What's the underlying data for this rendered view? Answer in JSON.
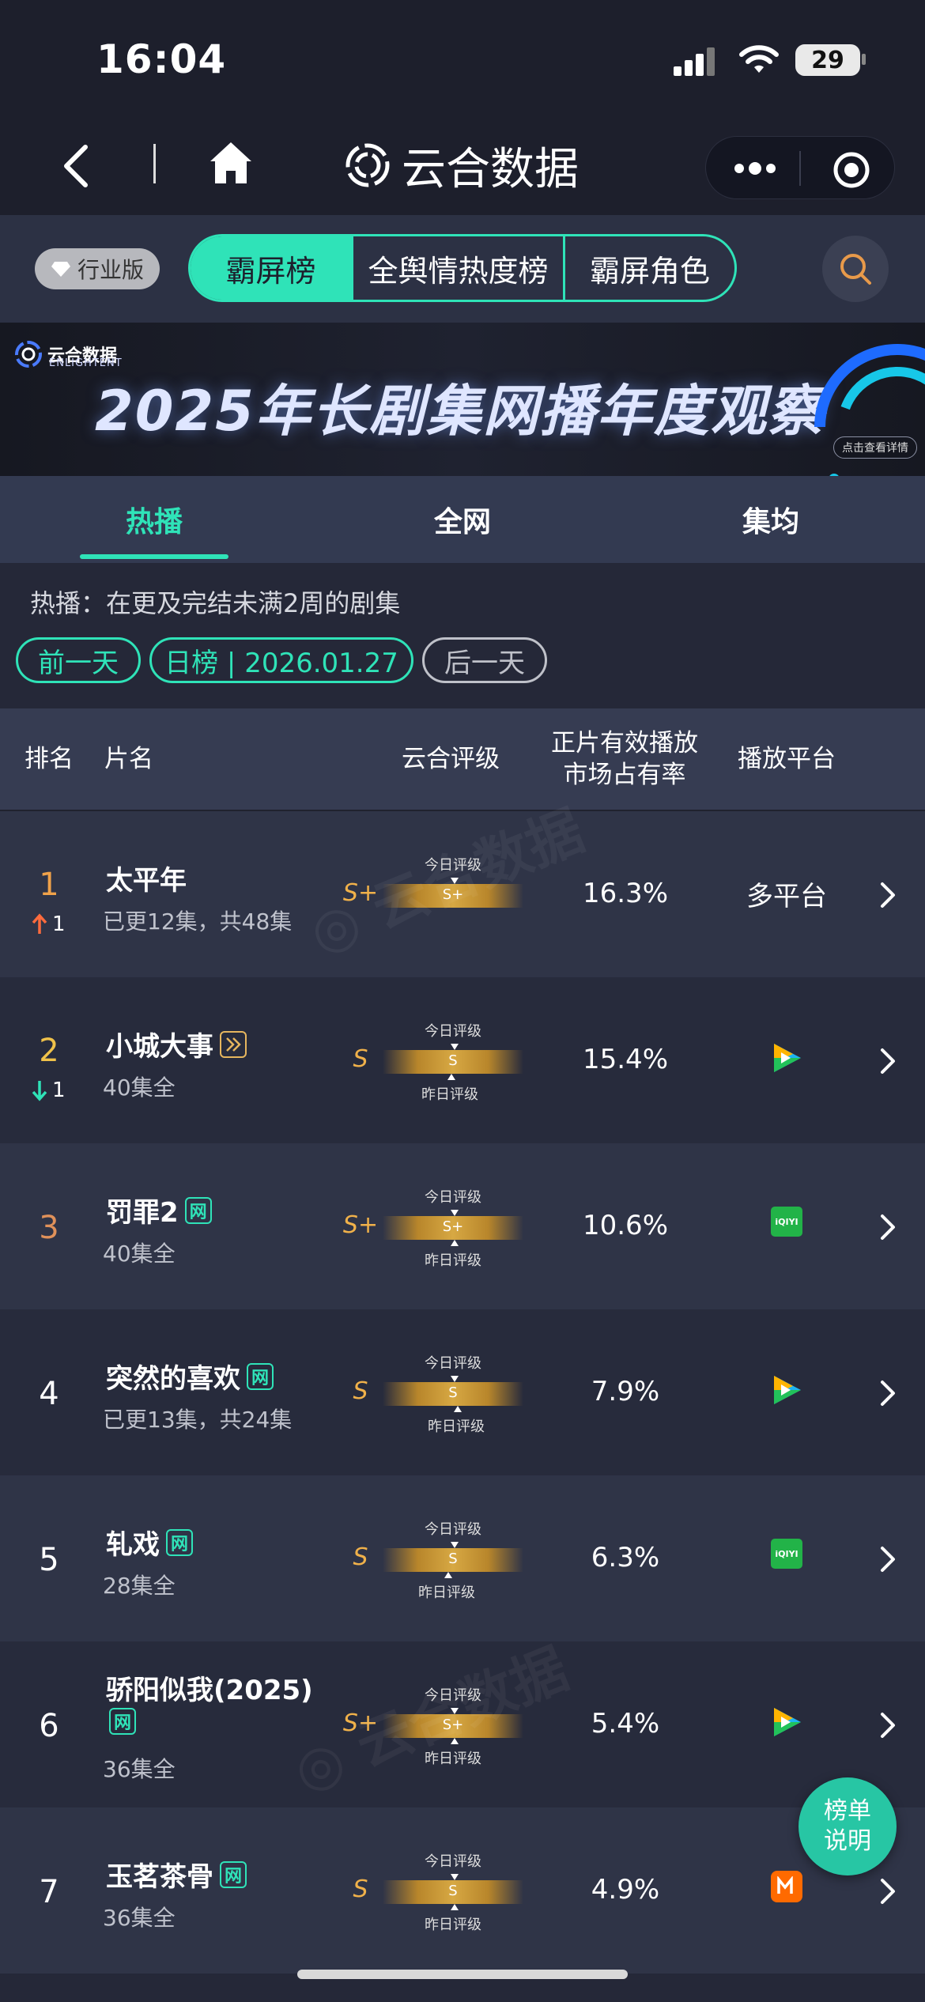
{
  "status_bar": {
    "time": "16:04",
    "battery": "29"
  },
  "nav": {
    "title": "云合数据"
  },
  "toolbar": {
    "edition": "行业版",
    "segments": [
      "霸屏榜",
      "全舆情热度榜",
      "霸屏角色"
    ],
    "active_segment": "霸屏榜"
  },
  "banner": {
    "logo": "云合数据",
    "logo_sub": "ENLIGHTENT",
    "title": "2025年长剧集网播年度观察",
    "detail_link": "点击查看详情"
  },
  "tabs": [
    {
      "label": "热播"
    },
    {
      "label": "全网"
    },
    {
      "label": "集均"
    }
  ],
  "info": {
    "description": "热播：在更及完结未满2周的剧集",
    "prev_day": "前一天",
    "date_pill": "日榜 | 2026.01.27",
    "next_day": "后一天"
  },
  "table": {
    "headers": {
      "rank": "排名",
      "name": "片名",
      "rating": "云合评级",
      "share_line1": "正片有效播放",
      "share_line2": "市场占有率",
      "platform": "播放平台"
    },
    "today_label": "今日评级",
    "yesterday_label": "昨日评级",
    "rows": [
      {
        "rank": "1",
        "trend": "up",
        "trend_value": "1",
        "name": "太平年",
        "tag": "",
        "sub": "已更12集，共48集",
        "grade": "S+",
        "bar_grade": "S+",
        "share": "16.3%",
        "platform": "多平台",
        "platform_icon": "text"
      },
      {
        "rank": "2",
        "trend": "down",
        "trend_value": "1",
        "name": "小城大事",
        "tag": "double-chevron-icon",
        "sub": "40集全",
        "grade": "S",
        "bar_grade": "S",
        "share": "15.4%",
        "platform": "",
        "platform_icon": "tencent-video-icon"
      },
      {
        "rank": "3",
        "trend": "",
        "trend_value": "",
        "name": "罚罪2",
        "tag": "网",
        "sub": "40集全",
        "grade": "S+",
        "bar_grade": "S+",
        "share": "10.6%",
        "platform": "iQIYI",
        "platform_icon": "iqiyi-icon"
      },
      {
        "rank": "4",
        "trend": "",
        "trend_value": "",
        "name": "突然的喜欢",
        "tag": "网",
        "sub": "已更13集，共24集",
        "grade": "S",
        "bar_grade": "S",
        "share": "7.9%",
        "platform": "",
        "platform_icon": "tencent-video-icon"
      },
      {
        "rank": "5",
        "trend": "",
        "trend_value": "",
        "name": "轧戏",
        "tag": "网",
        "sub": "28集全",
        "grade": "S",
        "bar_grade": "S",
        "share": "6.3%",
        "platform": "iQIYI",
        "platform_icon": "iqiyi-icon"
      },
      {
        "rank": "6",
        "trend": "",
        "trend_value": "",
        "name": "骄阳似我(2025)",
        "tag": "网",
        "sub": "36集全",
        "grade": "S+",
        "bar_grade": "S+",
        "share": "5.4%",
        "platform": "",
        "platform_icon": "tencent-video-icon"
      },
      {
        "rank": "7",
        "trend": "",
        "trend_value": "",
        "name": "玉茗茶骨",
        "tag": "网",
        "sub": "36集全",
        "grade": "S",
        "bar_grade": "S",
        "share": "4.9%",
        "platform": "",
        "platform_icon": "mango-tv-icon"
      }
    ]
  },
  "fab": {
    "line1": "榜单",
    "line2": "说明"
  },
  "colors": {
    "accent": "#2fe3b8",
    "gold": "#f0b14a",
    "up": "#ff6b3d",
    "down": "#2fe3b8"
  }
}
